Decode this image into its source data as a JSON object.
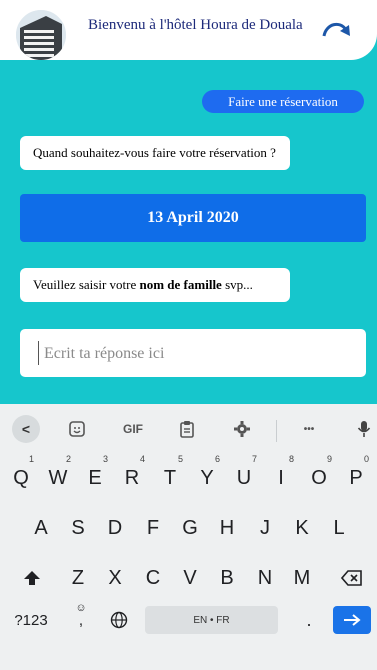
{
  "header": {
    "title": "Bienvenu à l'hôtel Houra de Douala",
    "avatar_icon": "hotel-building-icon",
    "refresh_icon": "redo-arrow-icon"
  },
  "chat": {
    "reservation_button": "Faire une réservation",
    "question_date": "Quand souhaitez-vous faire votre réservation ?",
    "answer_date": "13 April 2020",
    "question_name_before": "Veuillez saisir votre ",
    "question_name_bold": "nom de famille",
    "question_name_after": " svp...",
    "input_placeholder": "Ecrit ta réponse ici"
  },
  "colors": {
    "teal": "#16c6cc",
    "accent_blue": "#1e6bf0",
    "date_blue": "#0f6de8"
  },
  "keyboard": {
    "toolbar": [
      "<",
      "sticker-icon",
      "GIF",
      "clipboard-icon",
      "settings-gear-icon",
      "more-dots-icon",
      "microphone-icon"
    ],
    "toolbar_labels": {
      "back": "<",
      "gif": "GIF",
      "more": "•••"
    },
    "row1": [
      {
        "key": "Q",
        "hint": "1"
      },
      {
        "key": "W",
        "hint": "2"
      },
      {
        "key": "E",
        "hint": "3"
      },
      {
        "key": "R",
        "hint": "4"
      },
      {
        "key": "T",
        "hint": "5"
      },
      {
        "key": "Y",
        "hint": "6"
      },
      {
        "key": "U",
        "hint": "7"
      },
      {
        "key": "I",
        "hint": "8"
      },
      {
        "key": "O",
        "hint": "9"
      },
      {
        "key": "P",
        "hint": "0"
      }
    ],
    "row2": [
      "A",
      "S",
      "D",
      "F",
      "G",
      "H",
      "J",
      "K",
      "L"
    ],
    "row3": [
      "Z",
      "X",
      "C",
      "V",
      "B",
      "N",
      "M"
    ],
    "numbers_key": "?123",
    "comma_key": ",",
    "space_label": "EN • FR",
    "period_key": "."
  }
}
